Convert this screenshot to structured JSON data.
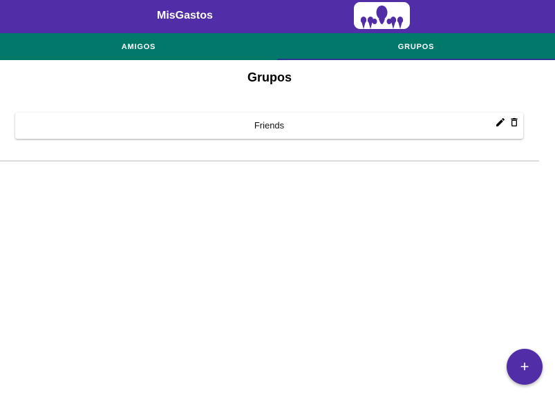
{
  "header": {
    "title": "MisGastos",
    "logo_icon": "group-people-icon",
    "background_color": "#512da8"
  },
  "tabs": {
    "items": [
      {
        "label": "AMIGOS",
        "active": false
      },
      {
        "label": "GRUPOS",
        "active": true
      }
    ],
    "background_color": "#00796b",
    "indicator_color": "#283593"
  },
  "main": {
    "title": "Grupos",
    "groups": [
      {
        "name": "Friends",
        "edit_icon": "pencil-icon",
        "delete_icon": "trash-icon"
      }
    ]
  },
  "fab": {
    "label": "+",
    "icon": "plus-icon",
    "color": "#512da8"
  }
}
